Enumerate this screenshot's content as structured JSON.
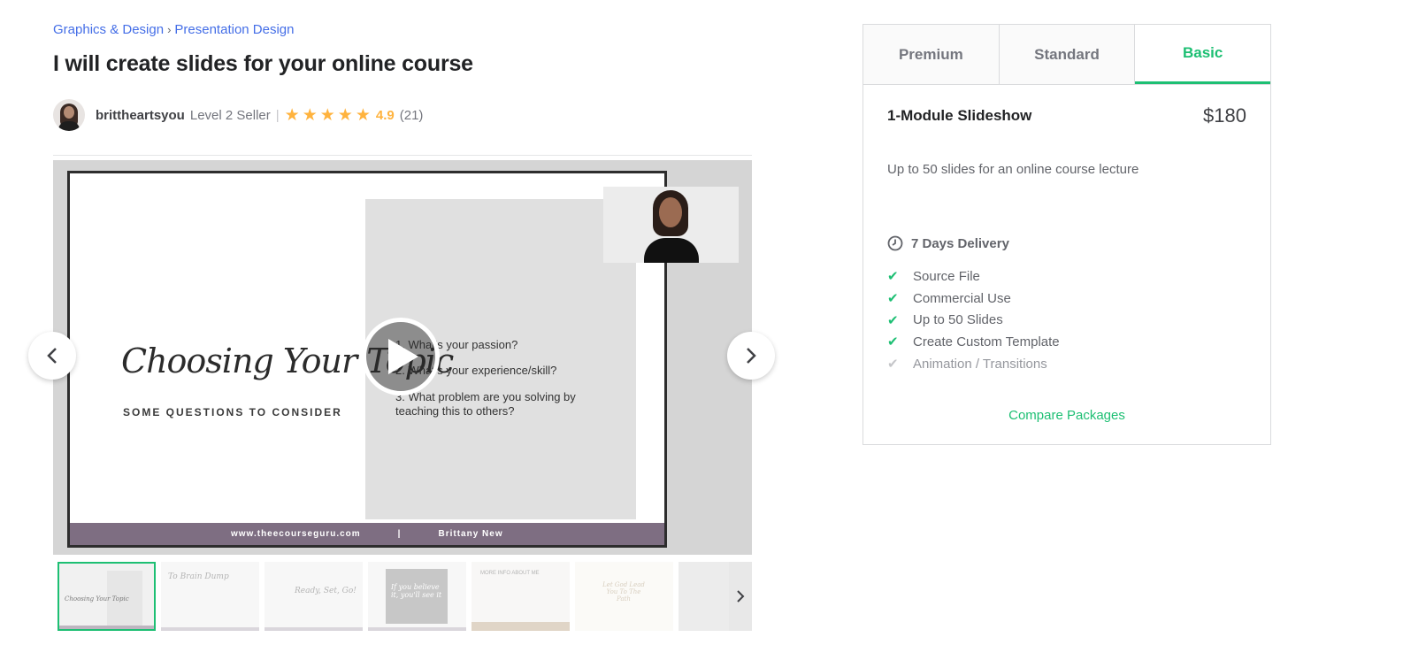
{
  "breadcrumb": {
    "items": [
      "Graphics & Design",
      "Presentation Design"
    ],
    "separator": "›"
  },
  "gig": {
    "title": "I will create slides for your online course"
  },
  "seller": {
    "name": "brittheartsyou",
    "level": "Level 2 Seller",
    "divider": "|",
    "rating": "4.9",
    "review_count": "(21)",
    "stars": 5
  },
  "gallery": {
    "slide": {
      "script_title": "Choosing Your Topic",
      "subtitle": "SOME QUESTIONS TO CONSIDER",
      "questions": [
        "1. What's your passion?",
        "2. What's your experience/skill?",
        "3. What problem are you solving by teaching this to others?"
      ],
      "footer_url": "www.theecourseguru.com",
      "footer_sep": "|",
      "footer_author": "Brittany New"
    },
    "thumbnails": [
      {
        "label": "Choosing Your Topic",
        "active": true
      },
      {
        "label": "To Brain Dump",
        "active": false
      },
      {
        "label": "Ready, Set, Go!",
        "active": false
      },
      {
        "label": "If you believe it, you'll see it",
        "active": false
      },
      {
        "label": "MORE INFO ABOUT ME",
        "active": false
      },
      {
        "label": "Let God Lead You To The Path",
        "active": false
      },
      {
        "label": "",
        "active": false
      }
    ]
  },
  "packages": {
    "tabs": [
      "Premium",
      "Standard",
      "Basic"
    ],
    "active_tab": "Basic",
    "name": "1-Module Slideshow",
    "price": "$180",
    "description": "Up to 50 slides for an online course lecture",
    "delivery": "7 Days Delivery",
    "features": [
      {
        "label": "Source File",
        "included": true
      },
      {
        "label": "Commercial Use",
        "included": true
      },
      {
        "label": "Up to 50 Slides",
        "included": true
      },
      {
        "label": "Create Custom Template",
        "included": true
      },
      {
        "label": "Animation / Transitions",
        "included": false
      }
    ],
    "compare_label": "Compare Packages"
  },
  "colors": {
    "accent": "#1dbf73",
    "link": "#446ee7",
    "star": "#ffb33e",
    "text": "#404145"
  },
  "icons": {
    "star": "star-icon",
    "clock": "clock-icon",
    "check": "check-icon",
    "play": "play-icon",
    "chevron_left": "chevron-left-icon",
    "chevron_right": "chevron-right-icon"
  }
}
